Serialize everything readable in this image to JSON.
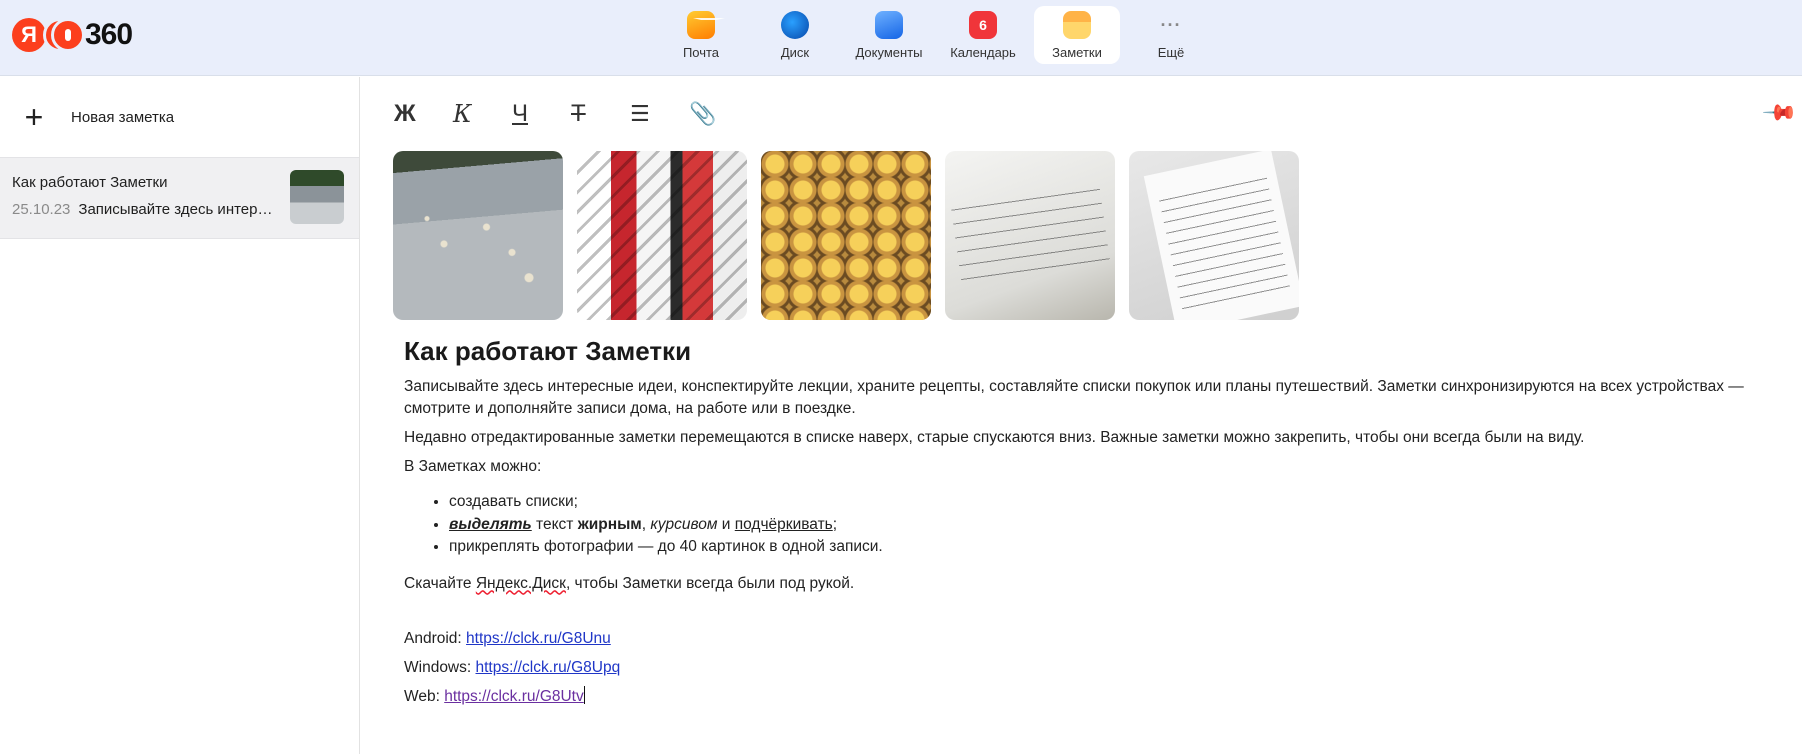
{
  "header": {
    "logo": {
      "ya": "Я",
      "text": "360"
    },
    "services": [
      {
        "label": "Почта",
        "icon": "mail-icon"
      },
      {
        "label": "Диск",
        "icon": "disk-icon"
      },
      {
        "label": "Документы",
        "icon": "docs-icon"
      },
      {
        "label": "Календарь",
        "icon": "calendar-icon",
        "badge": "6"
      },
      {
        "label": "Заметки",
        "icon": "notes-icon",
        "active": true
      },
      {
        "label": "Ещё",
        "icon": "more-icon",
        "glyph": "···"
      }
    ]
  },
  "sidebar": {
    "new_note_label": "Новая заметка",
    "notes": [
      {
        "title": "Как работают Заметки",
        "date": "25.10.23",
        "preview": "Записывайте здесь интересные идеи, конспектируйте лекции"
      }
    ]
  },
  "toolbar": {
    "bold": "Ж",
    "italic": "К",
    "underline": "Ч",
    "strike": "Т",
    "list": "☰",
    "attach": "📎"
  },
  "note": {
    "images": [
      "beach-photo",
      "graffiti-photo",
      "pastel-de-nata-photo",
      "whiteboard-photo",
      "receipt-photo"
    ],
    "title": "Как работают Заметки",
    "p1": "Записывайте здесь интересные идеи, конспектируйте лекции, храните рецепты, составляйте списки покупок или планы путешествий. Заметки синхронизируются на всех устройствах — смотрите и дополняйте записи дома, на работе или в поездке.",
    "p2": "Недавно отредактированные заметки перемещаются в списке наверх, старые спускаются вниз. Важные заметки можно закрепить, чтобы они всегда были на виду.",
    "p3": "В Заметках можно:",
    "list": {
      "item1": "создавать списки;",
      "item2": {
        "w1": "выделять",
        "w2": " текст ",
        "w3": "жирным",
        "w4": ", ",
        "w5": "курсивом",
        "w6": " и ",
        "w7": "подчёркивать",
        "w8": ";"
      },
      "item3": "прикреплять фотографии — до 40 картинок в одной записи."
    },
    "p4": {
      "before": "Скачайте ",
      "link": "Яндекс.Диск",
      "after": ", чтобы Заметки всегда были под рукой."
    },
    "links": [
      {
        "label": "Android: ",
        "url": "https://clck.ru/G8Unu"
      },
      {
        "label": "Windows: ",
        "url": "https://clck.ru/G8Upq"
      },
      {
        "label": "Web: ",
        "url": "https://clck.ru/G8Utv"
      }
    ]
  },
  "colors": {
    "header_bg": "#e9eefb",
    "brand_red": "#fc3f1d",
    "link": "#1f36c7",
    "visited_link": "#6a2fa0",
    "calendar_badge": "#f0353a"
  }
}
